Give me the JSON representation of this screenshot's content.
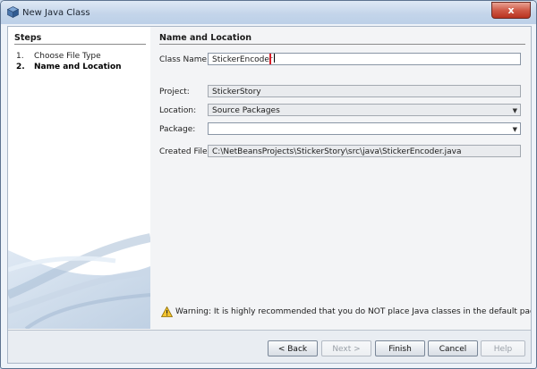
{
  "window": {
    "title": "New Java Class",
    "close_glyph": "x"
  },
  "steps": {
    "title": "Steps",
    "items": [
      {
        "num": "1.",
        "label": "Choose File Type",
        "active": false
      },
      {
        "num": "2.",
        "label": "Name and Location",
        "active": true
      }
    ]
  },
  "section": {
    "title": "Name and Location"
  },
  "form": {
    "class_name": {
      "label": "Class Name:",
      "value": "StickerEncoder"
    },
    "project": {
      "label": "Project:",
      "value": "StickerStory"
    },
    "location": {
      "label": "Location:",
      "value": "Source Packages"
    },
    "package": {
      "label": "Package:",
      "value": ""
    },
    "created_file": {
      "label": "Created File:",
      "value": "C:\\NetBeansProjects\\StickerStory\\src\\java\\StickerEncoder.java"
    }
  },
  "warning": {
    "text": "Warning: It is highly recommended that you do NOT place Java classes in the default package."
  },
  "buttons": {
    "back": "< Back",
    "next": "Next >",
    "finish": "Finish",
    "cancel": "Cancel",
    "help": "Help"
  },
  "colors": {
    "highlight": "#d71f2a",
    "accent": "#5d7390"
  }
}
